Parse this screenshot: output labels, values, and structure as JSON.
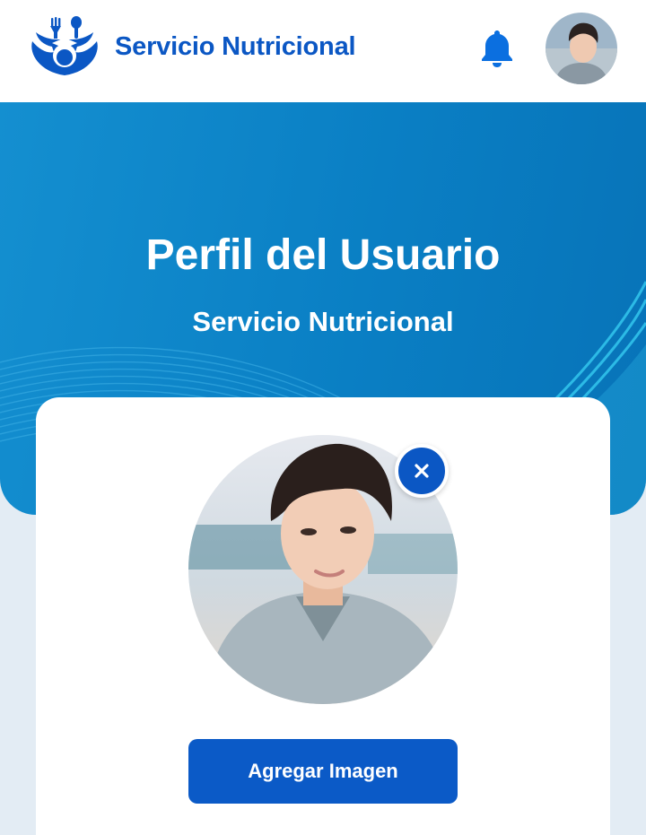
{
  "header": {
    "app_name": "Servicio Nutricional",
    "logo_icon": "nutrition-logo-icon",
    "notification_icon": "bell-icon",
    "avatar_icon": "user-avatar"
  },
  "hero": {
    "title": "Perfil del Usuario",
    "subtitle": "Servicio Nutricional"
  },
  "profile_card": {
    "photo": "profile-photo",
    "remove_icon": "close-icon",
    "add_image_label": "Agregar Imagen"
  },
  "colors": {
    "brand_blue": "#0b57c4",
    "hero_blue": "#0a7fc4",
    "page_background": "#e3ecf4",
    "card_background": "#ffffff"
  }
}
